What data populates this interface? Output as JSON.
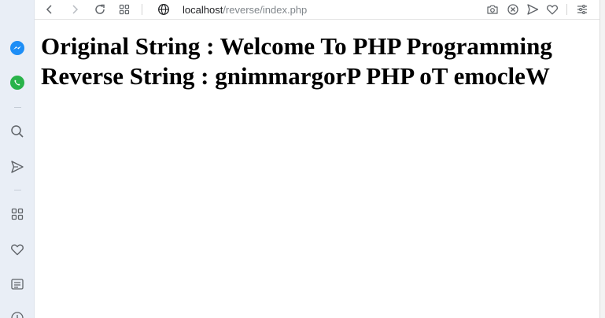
{
  "browser": {
    "url_host": "localhost",
    "url_path": "/reverse/index.php"
  },
  "toolbar": {
    "icons": [
      "back-icon",
      "forward-icon",
      "reload-icon",
      "tabs-grid-icon",
      "globe-icon",
      "camera-icon",
      "block-icon",
      "send-icon",
      "heart-icon",
      "menu-icon"
    ]
  },
  "sidebar": {
    "icons": [
      "messenger-icon",
      "whatsapp-icon",
      "search-icon",
      "send-icon",
      "grid-icon",
      "heart-icon",
      "notes-icon",
      "clock-icon"
    ]
  },
  "colors": {
    "messenger": "#1e8ef6",
    "whatsapp": "#29b34a",
    "sidebar_bg": "#e9eef6",
    "icon": "#5f6368"
  },
  "page": {
    "line1_label": "Original String : ",
    "line1_value": "Welcome To PHP Programming",
    "line2_label": "Reverse String : ",
    "line2_value": "gnimmargorP PHP oT emocleW"
  }
}
